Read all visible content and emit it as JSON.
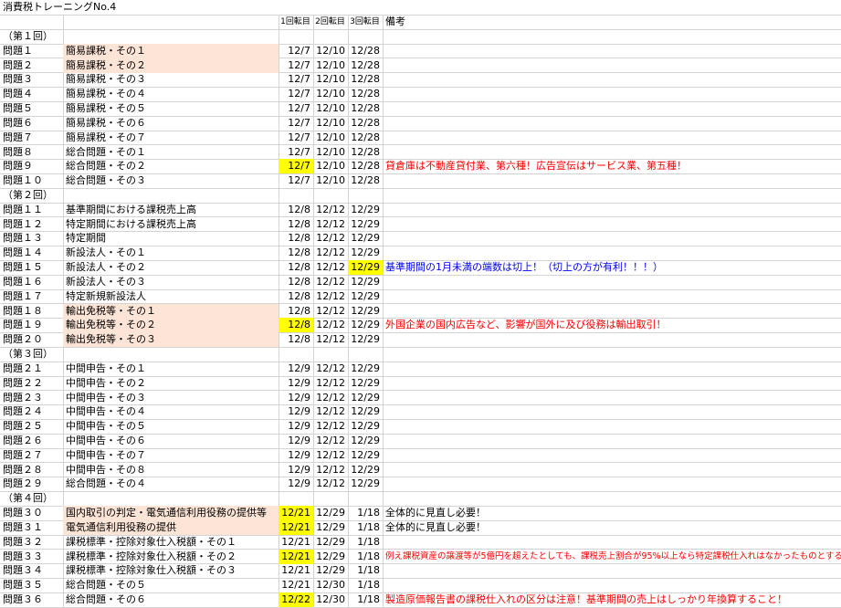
{
  "title": "消費税トレーニングNo.4",
  "headers": {
    "r1": "1回転目",
    "r2": "2回転目",
    "r3": "3回転目",
    "note": "備考"
  },
  "colors": {
    "peach": "#fce4d6",
    "yellow": "#ffff00",
    "red": "#ff0000",
    "blue": "#0000ff",
    "grid": "#d4d4d4"
  },
  "rows": [
    {
      "kind": "section",
      "label": "（第１回）"
    },
    {
      "q": "問題１",
      "topic": "簡易課税・その１",
      "r1": "12/7",
      "r2": "12/10",
      "r3": "12/28",
      "note": "",
      "topicHL": true
    },
    {
      "q": "問題２",
      "topic": "簡易課税・その２",
      "r1": "12/7",
      "r2": "12/10",
      "r3": "12/28",
      "note": "",
      "topicHL": true
    },
    {
      "q": "問題３",
      "topic": "簡易課税・その３",
      "r1": "12/7",
      "r2": "12/10",
      "r3": "12/28",
      "note": ""
    },
    {
      "q": "問題４",
      "topic": "簡易課税・その４",
      "r1": "12/7",
      "r2": "12/10",
      "r3": "12/28",
      "note": ""
    },
    {
      "q": "問題５",
      "topic": "簡易課税・その５",
      "r1": "12/7",
      "r2": "12/10",
      "r3": "12/28",
      "note": ""
    },
    {
      "q": "問題６",
      "topic": "簡易課税・その６",
      "r1": "12/7",
      "r2": "12/10",
      "r3": "12/28",
      "note": ""
    },
    {
      "q": "問題７",
      "topic": "簡易課税・その７",
      "r1": "12/7",
      "r2": "12/10",
      "r3": "12/28",
      "note": ""
    },
    {
      "q": "問題８",
      "topic": "総合問題・その１",
      "r1": "12/7",
      "r2": "12/10",
      "r3": "12/28",
      "note": ""
    },
    {
      "q": "問題９",
      "topic": "総合問題・その２",
      "r1": "12/7",
      "r2": "12/10",
      "r3": "12/28",
      "note": "貸倉庫は不動産貸付業、第六種！広告宣伝はサービス業、第五種！",
      "noteColor": "red",
      "r1HL": true
    },
    {
      "q": "問題１０",
      "topic": "総合問題・その３",
      "r1": "12/7",
      "r2": "12/10",
      "r3": "12/28",
      "note": ""
    },
    {
      "kind": "section",
      "label": "（第２回）"
    },
    {
      "q": "問題１１",
      "topic": "基準期間における課税売上高",
      "r1": "12/8",
      "r2": "12/12",
      "r3": "12/29",
      "note": ""
    },
    {
      "q": "問題１２",
      "topic": "特定期間における課税売上高",
      "r1": "12/8",
      "r2": "12/12",
      "r3": "12/29",
      "note": ""
    },
    {
      "q": "問題１３",
      "topic": "特定期間",
      "r1": "12/8",
      "r2": "12/12",
      "r3": "12/29",
      "note": ""
    },
    {
      "q": "問題１４",
      "topic": "新設法人・その１",
      "r1": "12/8",
      "r2": "12/12",
      "r3": "12/29",
      "note": ""
    },
    {
      "q": "問題１５",
      "topic": "新設法人・その２",
      "r1": "12/8",
      "r2": "12/12",
      "r3": "12/29",
      "note": "基準期間の1月未満の端数は切上！（切上の方が有利！！！）",
      "noteColor": "blue",
      "r3HL": true
    },
    {
      "q": "問題１６",
      "topic": "新設法人・その３",
      "r1": "12/8",
      "r2": "12/12",
      "r3": "12/29",
      "note": ""
    },
    {
      "q": "問題１７",
      "topic": "特定新規新設法人",
      "r1": "12/8",
      "r2": "12/12",
      "r3": "12/29",
      "note": ""
    },
    {
      "q": "問題１８",
      "topic": "輸出免税等・その１",
      "r1": "12/8",
      "r2": "12/12",
      "r3": "12/29",
      "note": "",
      "topicHL": true
    },
    {
      "q": "問題１９",
      "topic": "輸出免税等・その２",
      "r1": "12/8",
      "r2": "12/12",
      "r3": "12/29",
      "note": "外国企業の国内広告など、影響が国外に及び役務は輸出取引！",
      "noteColor": "red",
      "topicHL": true,
      "r1HL": true
    },
    {
      "q": "問題２０",
      "topic": "輸出免税等・その３",
      "r1": "12/8",
      "r2": "12/12",
      "r3": "12/29",
      "note": "",
      "topicHL": true
    },
    {
      "kind": "section",
      "label": "（第３回）"
    },
    {
      "q": "問題２１",
      "topic": "中間申告・その１",
      "r1": "12/9",
      "r2": "12/12",
      "r3": "12/29",
      "note": ""
    },
    {
      "q": "問題２２",
      "topic": "中間申告・その２",
      "r1": "12/9",
      "r2": "12/12",
      "r3": "12/29",
      "note": ""
    },
    {
      "q": "問題２３",
      "topic": "中間申告・その３",
      "r1": "12/9",
      "r2": "12/12",
      "r3": "12/29",
      "note": ""
    },
    {
      "q": "問題２４",
      "topic": "中間申告・その４",
      "r1": "12/9",
      "r2": "12/12",
      "r3": "12/29",
      "note": ""
    },
    {
      "q": "問題２５",
      "topic": "中間申告・その５",
      "r1": "12/9",
      "r2": "12/12",
      "r3": "12/29",
      "note": ""
    },
    {
      "q": "問題２６",
      "topic": "中間申告・その６",
      "r1": "12/9",
      "r2": "12/12",
      "r3": "12/29",
      "note": ""
    },
    {
      "q": "問題２７",
      "topic": "中間申告・その７",
      "r1": "12/9",
      "r2": "12/12",
      "r3": "12/29",
      "note": ""
    },
    {
      "q": "問題２８",
      "topic": "中間申告・その８",
      "r1": "12/9",
      "r2": "12/12",
      "r3": "12/29",
      "note": ""
    },
    {
      "q": "問題２９",
      "topic": "総合問題・その４",
      "r1": "12/9",
      "r2": "12/12",
      "r3": "12/29",
      "note": ""
    },
    {
      "kind": "section",
      "label": "（第４回）"
    },
    {
      "q": "問題３０",
      "topic": "国内取引の判定・電気通信利用役務の提供等",
      "r1": "12/21",
      "r2": "12/29",
      "r3": "1/18",
      "note": "全体的に見直し必要！",
      "noteColor": "black",
      "topicHL": true,
      "r1HL": true
    },
    {
      "q": "問題３１",
      "topic": "電気通信利用役務の提供",
      "r1": "12/21",
      "r2": "12/29",
      "r3": "1/18",
      "note": "全体的に見直し必要！",
      "noteColor": "black",
      "topicHL": true,
      "r1HL": true
    },
    {
      "q": "問題３２",
      "topic": "課税標準・控除対象仕入税額・その１",
      "r1": "12/21",
      "r2": "12/29",
      "r3": "1/18",
      "note": ""
    },
    {
      "q": "問題３３",
      "topic": "課税標準・控除対象仕入税額・その２",
      "r1": "12/21",
      "r2": "12/29",
      "r3": "1/18",
      "note": "例え課税資産の譲渡等が5億円を超えたとしても、課税売上割合が95%以上なら特定課税仕入れはなかったものとする",
      "noteColor": "red",
      "noteSmall": true,
      "r1HL": true
    },
    {
      "q": "問題３４",
      "topic": "課税標準・控除対象仕入税額・その３",
      "r1": "12/21",
      "r2": "12/29",
      "r3": "1/18",
      "note": ""
    },
    {
      "q": "問題３５",
      "topic": "総合問題・その５",
      "r1": "12/21",
      "r2": "12/30",
      "r3": "1/18",
      "note": ""
    },
    {
      "q": "問題３６",
      "topic": "総合問題・その６",
      "r1": "12/22",
      "r2": "12/30",
      "r3": "1/18",
      "note": "製造原価報告書の課税仕入れの区分は注意！基準期間の売上はしっかり年換算すること！",
      "noteColor": "red",
      "r1HL": true
    }
  ]
}
